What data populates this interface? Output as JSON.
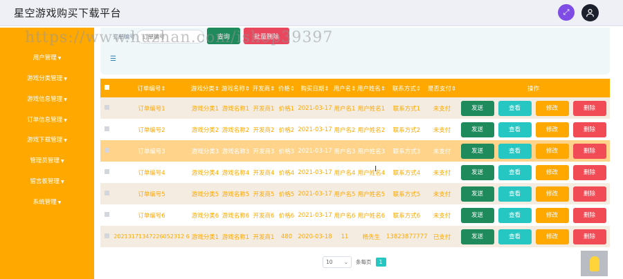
{
  "app": {
    "title": "星空游戏购买下载平台"
  },
  "sidebar": {
    "items": [
      {
        "label": "用户管理"
      },
      {
        "label": "游戏分类管理"
      },
      {
        "label": "游戏信息管理"
      },
      {
        "label": "订单信息管理"
      },
      {
        "label": "游戏下载管理"
      },
      {
        "label": "管理员管理"
      },
      {
        "label": "留言板管理"
      },
      {
        "label": "系统管理"
      }
    ]
  },
  "search": {
    "label": "订单编号",
    "placeholder": "订单编号",
    "search_label": "查询",
    "batch_delete_label": "批量删除"
  },
  "table": {
    "columns": [
      "订单编号",
      "游戏分类",
      "游戏名称",
      "开发商",
      "价格",
      "购买日期",
      "用户名",
      "用户姓名",
      "联系方式",
      "是否支付",
      "操作"
    ],
    "rows": [
      [
        "订单编号1",
        "游戏分类1",
        "游戏名称1",
        "开发商1",
        "价格1",
        "2021-03-17",
        "用户名1",
        "用户姓名1",
        "联系方式1",
        "未支付"
      ],
      [
        "订单编号2",
        "游戏分类2",
        "游戏名称2",
        "开发商2",
        "价格2",
        "2021-03-17",
        "用户名2",
        "用户姓名2",
        "联系方式2",
        "未支付"
      ],
      [
        "订单编号3",
        "游戏分类3",
        "游戏名称3",
        "开发商3",
        "价格3",
        "2021-03-17",
        "用户名3",
        "用户姓名3",
        "联系方式3",
        "未支付"
      ],
      [
        "订单编号4",
        "游戏分类4",
        "游戏名称4",
        "开发商4",
        "价格4",
        "2021-03-17",
        "用户名4",
        "用户姓名4",
        "联系方式4",
        "未支付"
      ],
      [
        "订单编号5",
        "游戏分类5",
        "游戏名称5",
        "开发商5",
        "价格5",
        "2021-03-17",
        "用户名5",
        "用户姓名5",
        "联系方式5",
        "未支付"
      ],
      [
        "订单编号6",
        "游戏分类6",
        "游戏名称6",
        "开发商6",
        "价格6",
        "2021-03-17",
        "用户名6",
        "用户姓名6",
        "联系方式6",
        "未支付"
      ],
      [
        "20213171347226052312 6",
        "游戏分类1",
        "游戏名称1",
        "开发商1",
        "480",
        "2020-03-18",
        "11",
        "杨先生",
        "13823877777",
        "已支付"
      ]
    ],
    "action_labels": {
      "send": "发送",
      "view": "查看",
      "edit": "修改",
      "delete": "删除"
    }
  },
  "pagination": {
    "page_size": "10",
    "per_page_label": "条每页",
    "current_page": "1"
  },
  "watermark": "https://www.huzhan.com/ishop39397",
  "colors": {
    "accent": "#ffa800",
    "send": "#1f8a5c",
    "view": "#26c6c2",
    "edit": "#ffa800",
    "delete": "#f14c55"
  }
}
